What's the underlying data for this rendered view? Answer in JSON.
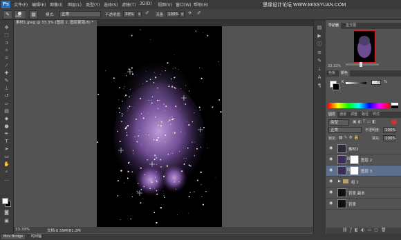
{
  "app": {
    "logo": "Ps",
    "watermark": "思缘设计论坛 WWW.MISSYUAN.COM"
  },
  "menu": [
    "文件(F)",
    "编辑(E)",
    "图像(I)",
    "图层(L)",
    "类型(Y)",
    "选择(S)",
    "滤镜(T)",
    "3D(D)",
    "视图(V)",
    "窗口(W)",
    "帮助(H)"
  ],
  "options": {
    "brush_size": "249",
    "mode_label": "模式:",
    "mode_value": "正常",
    "opacity_label": "不透明度:",
    "opacity_value": "30%",
    "flow_label": "流量:",
    "flow_value": "100%"
  },
  "document": {
    "tab_title": "素材1.jpeg @ 33.3% (图层 1, 图层蒙版/8) *"
  },
  "status": {
    "zoom": "33.33%",
    "doc_info": "文档:6.59M/81.2M"
  },
  "bottom_tabs": [
    "Mini Bridge",
    "时间轴"
  ],
  "panels": {
    "navigator_tabs": [
      "导航器",
      "直方图"
    ],
    "navigator_zoom": "33.33%",
    "color_tabs": [
      "色板",
      "颜色"
    ],
    "color_k_label": "K",
    "color_k_value": "0",
    "color_k_unit": "%",
    "adjust_tabs": [
      "图层",
      "通道",
      "调整",
      "路径",
      "样式"
    ],
    "layers_filter": "类型",
    "blend_mode": "正常",
    "opacity_label": "不透明度:",
    "opacity_value": "100%",
    "lock_label": "锁定:",
    "fill_label": "填充:",
    "fill_value": "100%"
  },
  "layers": [
    {
      "name": "素材2",
      "has_mask": false,
      "selected": false,
      "group": false
    },
    {
      "name": "图层 2",
      "has_mask": true,
      "selected": false,
      "group": false
    },
    {
      "name": "图层 3",
      "has_mask": true,
      "selected": true,
      "group": false
    },
    {
      "name": "组 1",
      "has_mask": false,
      "selected": false,
      "group": true
    },
    {
      "name": "背景 副本",
      "has_mask": false,
      "selected": false,
      "group": false
    },
    {
      "name": "背景",
      "has_mask": false,
      "selected": false,
      "group": false
    }
  ]
}
